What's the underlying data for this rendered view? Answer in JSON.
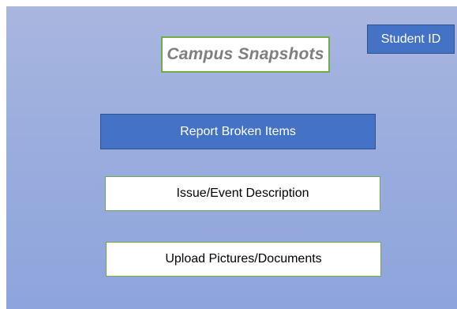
{
  "header": {
    "title": "Campus Snapshots",
    "student_id_label": "Student ID"
  },
  "actions": {
    "report_label": "Report Broken Items",
    "description_label": "Issue/Event Description",
    "upload_label": "Upload Pictures/Documents"
  },
  "colors": {
    "background_top": "#a9b6df",
    "background_bottom": "#8ea4dc",
    "button_blue": "#4472c4",
    "border_green": "#70ad47",
    "title_text": "#7f7f7f"
  }
}
